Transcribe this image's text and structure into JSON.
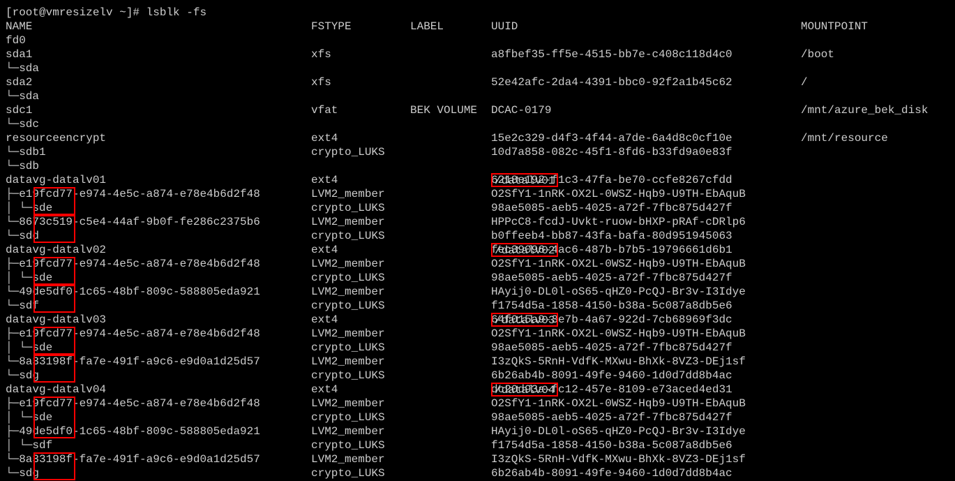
{
  "prompt": "[root@vmresizelv ~]# lsblk -fs",
  "headers": {
    "name": "NAME",
    "fstype": "FSTYPE",
    "label": "LABEL",
    "uuid": "UUID",
    "mount": "MOUNTPOINT"
  },
  "rows": [
    {
      "name": "fd0"
    },
    {
      "name": "sda1",
      "fstype": "xfs",
      "uuid": "a8fbef35-ff5e-4515-bb7e-c408c118d4c0",
      "mount": "/boot"
    },
    {
      "name": "└─sda"
    },
    {
      "name": "sda2",
      "fstype": "xfs",
      "uuid": "52e42afc-2da4-4391-bbc0-92f2a1b45c62",
      "mount": "/"
    },
    {
      "name": "└─sda"
    },
    {
      "name": "sdc1",
      "fstype": "vfat",
      "label": "BEK VOLUME",
      "uuid": "DCAC-0179",
      "mount": "/mnt/azure_bek_disk"
    },
    {
      "name": "└─sdc"
    },
    {
      "name": "resourceencrypt",
      "fstype": "ext4",
      "uuid": "15e2c329-d4f3-4f44-a7de-6a4d8c0cf10e",
      "mount": "/mnt/resource"
    },
    {
      "name": "└─sdb1",
      "fstype": "crypto_LUKS",
      "uuid": "10d7a858-082c-45f1-8fd6-b33fd9a0e83f"
    },
    {
      "name": "  └─sdb"
    },
    {
      "name": "datavg-datalv01",
      "fstype": "ext4",
      "uuid": "6218e192-f1c3-47fa-be70-ccfe8267cfdd",
      "mount": "/datalv01",
      "mountBox": true
    },
    {
      "name": "├─e19fcd77-e974-4e5c-a874-e78e4b6d2f48",
      "fstype": "LVM2_member",
      "uuid": "O2SfY1-1nRK-OX2L-0WSZ-Hqb9-U9TH-EbAquB",
      "devBox": "h40"
    },
    {
      "name": "│ └─sde",
      "fstype": "crypto_LUKS",
      "uuid": "98ae5085-aeb5-4025-a72f-7fbc875d427f"
    },
    {
      "name": "└─8673c519-c5e4-44af-9b0f-fe286c2375b6",
      "fstype": "LVM2_member",
      "uuid": "HPPcC8-fcdJ-Uvkt-ruow-bHXP-pRAf-cDRlp6",
      "devBox": "h40"
    },
    {
      "name": "  └─sdd",
      "fstype": "crypto_LUKS",
      "uuid": "b0ffeeb4-bb87-43fa-bafa-80d951945063"
    },
    {
      "name": "datavg-datalv02",
      "fstype": "ext4",
      "uuid": "fec39096-4ac6-487b-b7b5-19796661d6b1",
      "mount": "/datalv02",
      "mountBox": true
    },
    {
      "name": "├─e19fcd77-e974-4e5c-a874-e78e4b6d2f48",
      "fstype": "LVM2_member",
      "uuid": "O2SfY1-1nRK-OX2L-0WSZ-Hqb9-U9TH-EbAquB",
      "devBox": "h40"
    },
    {
      "name": "│ └─sde",
      "fstype": "crypto_LUKS",
      "uuid": "98ae5085-aeb5-4025-a72f-7fbc875d427f"
    },
    {
      "name": "└─49de5df0-1c65-48bf-809c-588805eda921",
      "fstype": "LVM2_member",
      "uuid": "HAyij0-DL0l-oS65-qHZ0-PcQJ-Br3v-I3Idye",
      "devBox": "h40"
    },
    {
      "name": "  └─sdf",
      "fstype": "crypto_LUKS",
      "uuid": "f1754d5a-1858-4150-b38a-5c087a8db5e6"
    },
    {
      "name": "datavg-datalv03",
      "fstype": "ext4",
      "uuid": "64f015a9-3e7b-4a67-922d-7cb68969f3dc",
      "mount": "/datalv03",
      "mountBox": true
    },
    {
      "name": "├─e19fcd77-e974-4e5c-a874-e78e4b6d2f48",
      "fstype": "LVM2_member",
      "uuid": "O2SfY1-1nRK-OX2L-0WSZ-Hqb9-U9TH-EbAquB",
      "devBox": "h40"
    },
    {
      "name": "│ └─sde",
      "fstype": "crypto_LUKS",
      "uuid": "98ae5085-aeb5-4025-a72f-7fbc875d427f"
    },
    {
      "name": "└─8a33198f-fa7e-491f-a9c6-e9d0a1d25d57",
      "fstype": "LVM2_member",
      "uuid": "I3zQkS-5RnH-VdfK-MXwu-BhXk-8VZ3-DEj1sf",
      "devBox": "h40"
    },
    {
      "name": "  └─sdg",
      "fstype": "crypto_LUKS",
      "uuid": "6b26ab4b-8091-49fe-9460-1d0d7dd8b4ac"
    },
    {
      "name": "datavg-datalv04",
      "fstype": "ext4",
      "uuid": "dc20d93a-fc12-457e-8109-e73aced4ed31",
      "mount": "/datalv04",
      "mountBox": true
    },
    {
      "name": "├─e19fcd77-e974-4e5c-a874-e78e4b6d2f48",
      "fstype": "LVM2_member",
      "uuid": "O2SfY1-1nRK-OX2L-0WSZ-Hqb9-U9TH-EbAquB",
      "devBox": "h60"
    },
    {
      "name": "│ └─sde",
      "fstype": "crypto_LUKS",
      "uuid": "98ae5085-aeb5-4025-a72f-7fbc875d427f"
    },
    {
      "name": "├─49de5df0-1c65-48bf-809c-588805eda921",
      "fstype": "LVM2_member",
      "uuid": "HAyij0-DL0l-oS65-qHZ0-PcQJ-Br3v-I3Idye"
    },
    {
      "name": "│ └─sdf",
      "fstype": "crypto_LUKS",
      "uuid": "f1754d5a-1858-4150-b38a-5c087a8db5e6"
    },
    {
      "name": "└─8a33198f-fa7e-491f-a9c6-e9d0a1d25d57",
      "fstype": "LVM2_member",
      "uuid": "I3zQkS-5RnH-VdfK-MXwu-BhXk-8VZ3-DEj1sf",
      "devBox": "h40"
    },
    {
      "name": "  └─sdg",
      "fstype": "crypto_LUKS",
      "uuid": "6b26ab4b-8091-49fe-9460-1d0d7dd8b4ac"
    }
  ]
}
